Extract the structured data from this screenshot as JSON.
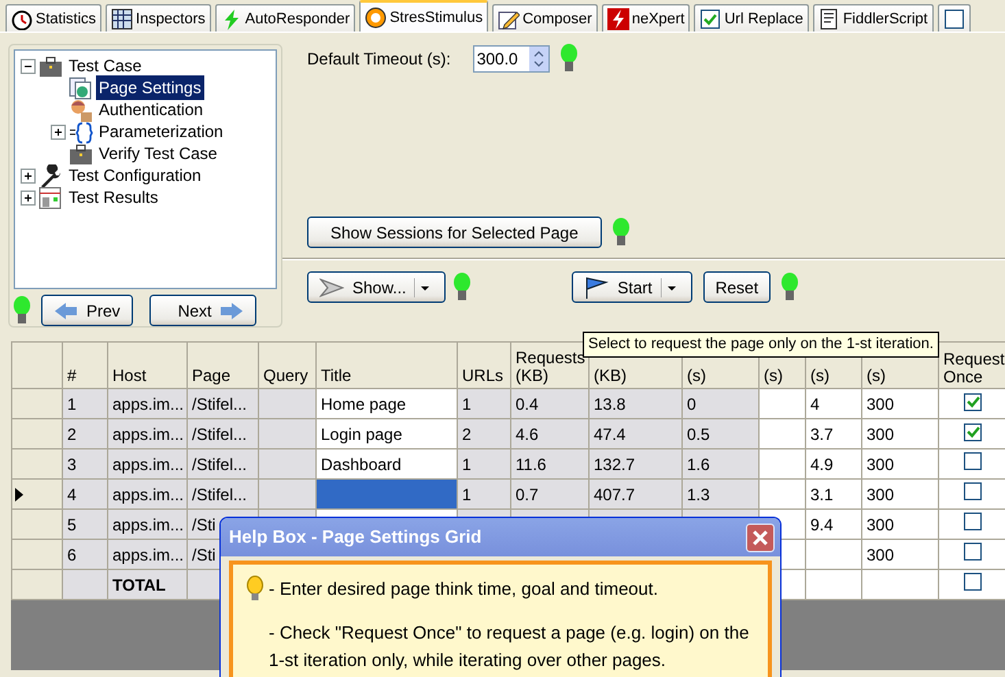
{
  "tabs": [
    {
      "label": "Statistics",
      "selected": false
    },
    {
      "label": "Inspectors",
      "selected": false
    },
    {
      "label": "AutoResponder",
      "selected": false
    },
    {
      "label": "StresStimulus",
      "selected": true
    },
    {
      "label": "Composer",
      "selected": false
    },
    {
      "label": "neXpert",
      "selected": false
    },
    {
      "label": "Url Replace",
      "selected": false
    },
    {
      "label": "FiddlerScript",
      "selected": false
    },
    {
      "selected": false
    }
  ],
  "tree": [
    {
      "label": "Test Case",
      "expanded": true,
      "selected": false,
      "children": [
        {
          "label": "Page Settings",
          "selected": true
        },
        {
          "label": "Authentication",
          "selected": false
        },
        {
          "label": "Parameterization",
          "expanded": false,
          "selected": false
        },
        {
          "label": "Verify Test Case",
          "selected": false
        }
      ]
    },
    {
      "label": "Test Configuration",
      "expanded": false,
      "selected": false
    },
    {
      "label": "Test Results",
      "expanded": false,
      "selected": false
    }
  ],
  "nav_buttons": [
    "Prev",
    "Next"
  ],
  "default_timeout": {
    "label": "Default Timeout (s):",
    "value": "300.0"
  },
  "sessions_button": "Show Sessions for Selected Page",
  "toolbar": {
    "show": "Show...",
    "start": "Start",
    "reset": "Reset"
  },
  "tooltip": "Select to request the page only on the 1-st iteration.",
  "grid": {
    "columns": [
      {
        "label": "#",
        "kind": "data"
      },
      {
        "label": "Host",
        "kind": "data"
      },
      {
        "label": "Page",
        "kind": "data"
      },
      {
        "label": "Query",
        "kind": "data"
      },
      {
        "label": "Title",
        "kind": "edit"
      },
      {
        "label": "URLs",
        "kind": "data"
      },
      {
        "label": "Requests (KB)",
        "kind": "data"
      },
      {
        "label": "(KB)",
        "kind": "data"
      },
      {
        "label": "(s)",
        "kind": "data"
      },
      {
        "label": "(s)",
        "kind": "edit"
      },
      {
        "label": "(s)",
        "kind": "edit"
      },
      {
        "label": "(s)",
        "kind": "edit"
      },
      {
        "label": "Request Once",
        "kind": "check"
      }
    ],
    "rows": [
      {
        "cells": [
          "1",
          "apps.im...",
          "/Stifel...",
          "",
          "Home page",
          "1",
          "0.4",
          "13.8",
          "0",
          "",
          "4",
          "300"
        ],
        "request_once": true,
        "selected": false
      },
      {
        "cells": [
          "2",
          "apps.im...",
          "/Stifel...",
          "",
          "Login page",
          "2",
          "4.6",
          "47.4",
          "0.5",
          "",
          "3.7",
          "300"
        ],
        "request_once": true,
        "selected": false
      },
      {
        "cells": [
          "3",
          "apps.im...",
          "/Stifel...",
          "",
          "Dashboard",
          "1",
          "11.6",
          "132.7",
          "1.6",
          "",
          "4.9",
          "300"
        ],
        "request_once": false,
        "selected": false
      },
      {
        "cells": [
          "4",
          "apps.im...",
          "/Stifel...",
          "",
          "",
          "1",
          "0.7",
          "407.7",
          "1.3",
          "",
          "3.1",
          "300"
        ],
        "request_once": false,
        "selected": true
      },
      {
        "cells": [
          "5",
          "apps.im...",
          "/Sti",
          "",
          "",
          "",
          "",
          "",
          "",
          "",
          "9.4",
          "300"
        ],
        "request_once": false,
        "selected": false
      },
      {
        "cells": [
          "6",
          "apps.im...",
          "/Sti",
          "",
          "",
          "",
          "",
          "",
          "",
          "",
          "",
          "300"
        ],
        "request_once": false,
        "selected": false
      },
      {
        "cells": [
          "",
          "TOTAL",
          "",
          "",
          "",
          "",
          "",
          "",
          "",
          "",
          "",
          ""
        ],
        "request_once": false,
        "selected": false,
        "kind": "total"
      }
    ]
  },
  "help_box": {
    "title": "Help Box - Page Settings Grid",
    "paragraphs": [
      "- Enter desired page think time, goal and timeout.",
      "- Check \"Request Once\" to request a page (e.g. login) on the 1-st iteration only, while iterating over other pages."
    ]
  }
}
